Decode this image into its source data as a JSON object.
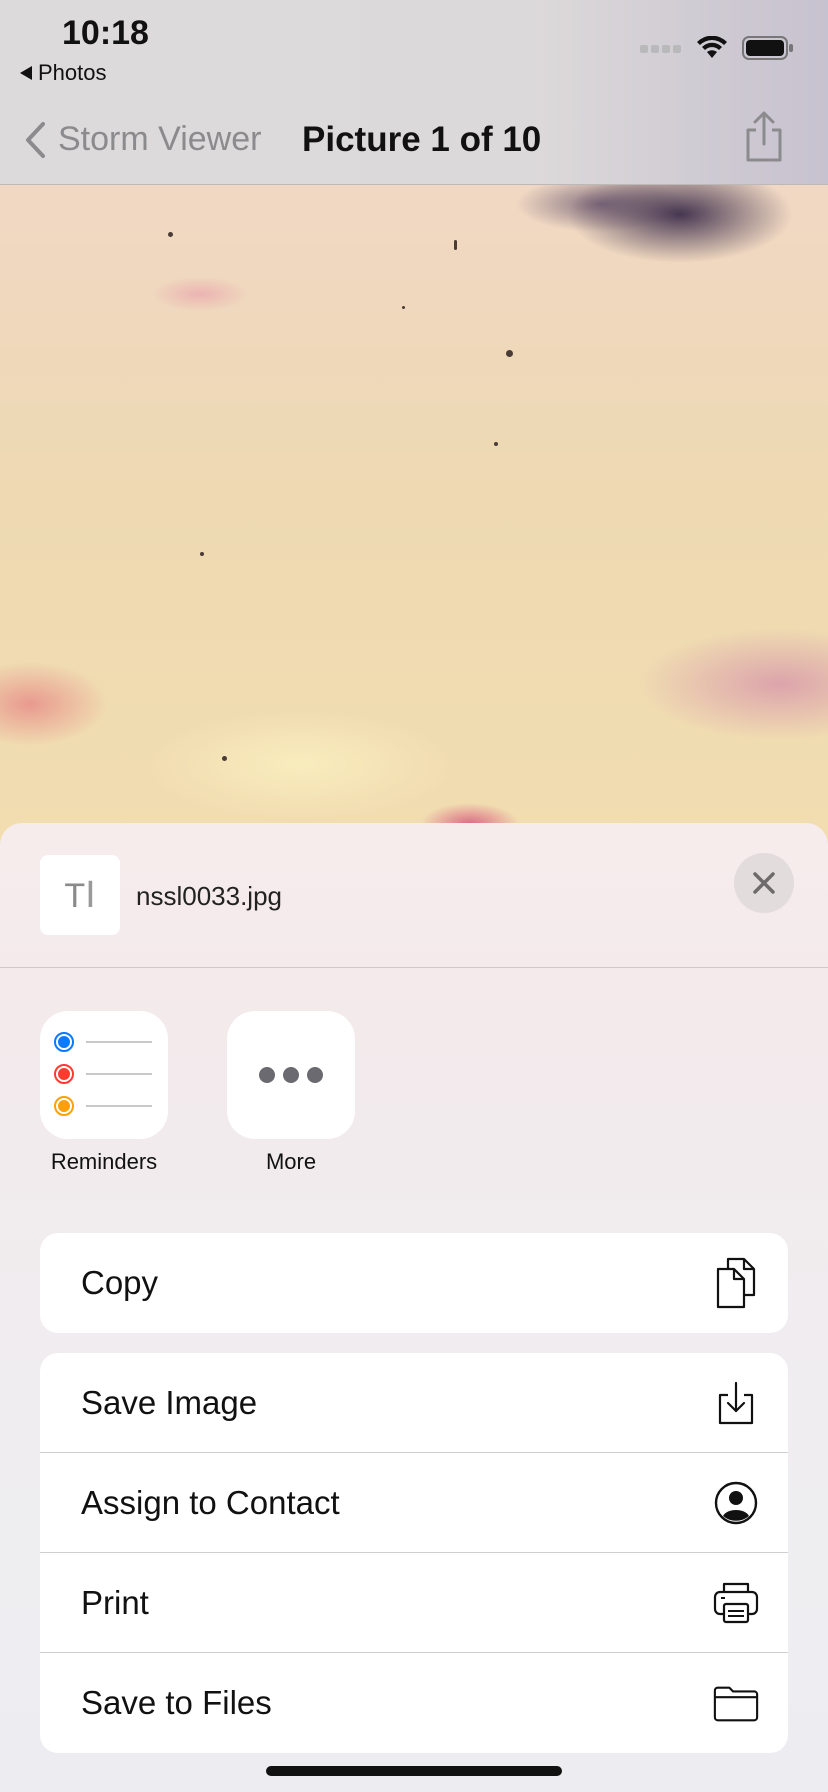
{
  "status_bar": {
    "time": "10:18",
    "back_app_label": "Photos",
    "icons": [
      "signal-icon",
      "wifi-icon",
      "battery-icon"
    ]
  },
  "nav": {
    "back_label": "Storm Viewer",
    "title": "Picture 1 of 10",
    "share_icon": "share-icon"
  },
  "share_sheet": {
    "file_name": "nssl0033.jpg",
    "close_icon": "close-icon",
    "apps": [
      {
        "label": "Reminders",
        "icon": "reminders-icon"
      },
      {
        "label": "More",
        "icon": "more-icon"
      }
    ],
    "actions_group_1": [
      {
        "label": "Copy",
        "icon": "copy-icon"
      }
    ],
    "actions_group_2": [
      {
        "label": "Save Image",
        "icon": "save-image-icon"
      },
      {
        "label": "Assign to Contact",
        "icon": "contact-icon"
      },
      {
        "label": "Print",
        "icon": "printer-icon"
      },
      {
        "label": "Save to Files",
        "icon": "folder-icon"
      }
    ]
  },
  "colors": {
    "reminder_blue": "#0a7aff",
    "reminder_red": "#ff3b30",
    "reminder_orange": "#ff9f0a"
  }
}
